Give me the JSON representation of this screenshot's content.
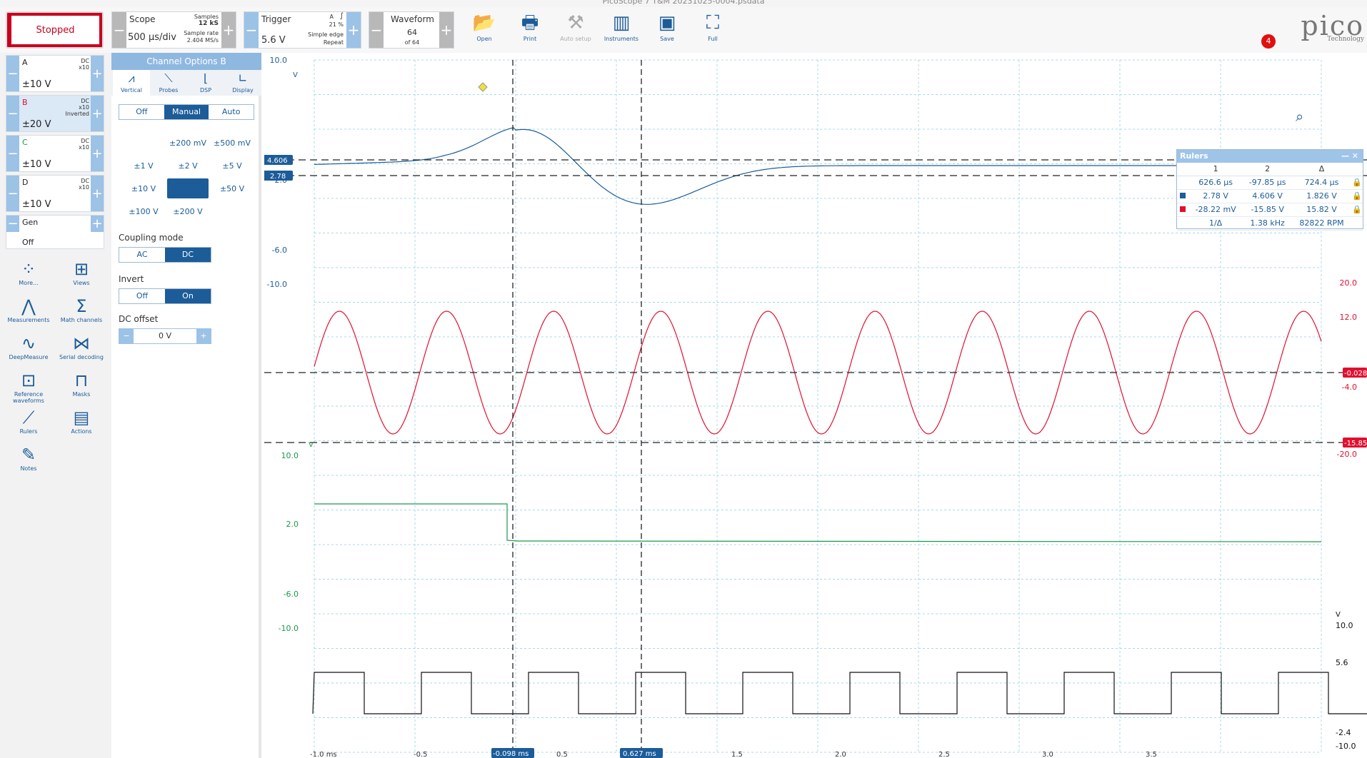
{
  "title": "PicoScope 7 T&M 20231025-0004.psdata",
  "toolbar": {
    "stop_label": "Stopped",
    "scope": {
      "label": "Scope",
      "timebase": "500 µs/div",
      "samples_label": "Samples",
      "samples": "12 kS",
      "rate_label": "Sample rate",
      "rate": "2.404 MS/s"
    },
    "trigger": {
      "label": "Trigger",
      "level": "5.6 V",
      "channel": "A",
      "pretrigger": "21 %",
      "type": "Simple edge",
      "mode": "Repeat"
    },
    "waveform": {
      "label": "Waveform",
      "current": "64",
      "of": "of 64"
    },
    "buttons": [
      {
        "label": "Open",
        "icon": "folder-icon"
      },
      {
        "label": "Print",
        "icon": "printer-icon"
      },
      {
        "label": "Auto setup",
        "icon": "wand-icon"
      },
      {
        "label": "Instruments",
        "icon": "instruments-icon"
      },
      {
        "label": "Save",
        "icon": "save-icon"
      },
      {
        "label": "Full",
        "icon": "fullscreen-icon"
      }
    ],
    "logo": "pico",
    "logo_sub": "Technology",
    "notifications": "4"
  },
  "channels": [
    {
      "name": "A",
      "coupling": "DC",
      "probe": "x10",
      "range": "±10 V",
      "extra": ""
    },
    {
      "name": "B",
      "coupling": "DC",
      "probe": "x10",
      "range": "±20 V",
      "extra": "Inverted"
    },
    {
      "name": "C",
      "coupling": "DC",
      "probe": "x10",
      "range": "±10 V",
      "extra": ""
    },
    {
      "name": "D",
      "coupling": "DC",
      "probe": "x10",
      "range": "±10 V",
      "extra": ""
    }
  ],
  "gen": {
    "name": "Gen",
    "state": "Off"
  },
  "tools": [
    "More...",
    "Views",
    "Measurements",
    "Math channels",
    "DeepMeasure",
    "Serial decoding",
    "Reference waveforms",
    "Masks",
    "Rulers",
    "Actions",
    "Notes"
  ],
  "channel_options": {
    "title": "Channel Options",
    "channel": "B",
    "tabs": [
      "Vertical",
      "Probes",
      "DSP",
      "Display"
    ],
    "range_mode": [
      "Off",
      "Manual",
      "Auto"
    ],
    "ranges": [
      "±200 mV",
      "±500 mV",
      "±1 V",
      "±2 V",
      "±5 V",
      "±10 V",
      "±20 V",
      "±50 V",
      "±100 V",
      "±200 V"
    ],
    "coupling_label": "Coupling mode",
    "coupling": [
      "AC",
      "DC"
    ],
    "invert_label": "Invert",
    "invert": [
      "Off",
      "On"
    ],
    "offset_label": "DC offset",
    "offset": "0 V"
  },
  "axes": {
    "blue": {
      "unit": "V",
      "ticks": [
        "10.0",
        "2.0",
        "-6.0",
        "-10.0"
      ],
      "marker1": "4.606",
      "marker2": "2.78"
    },
    "red": {
      "ticks": [
        "20.0",
        "12.0",
        "-4.0",
        "-20.0"
      ],
      "marker1": "-0.028",
      "marker2": "-15.85"
    },
    "green": {
      "unit": "V",
      "ticks": [
        "10.0",
        "2.0",
        "-6.0",
        "-10.0"
      ]
    },
    "black": {
      "unit": "V",
      "ticks": [
        "10.0",
        "5.6",
        "-2.4",
        "-10.0"
      ]
    },
    "time": [
      "-1.0 ms",
      "-0.5",
      "0.5",
      "1.0",
      "1.5",
      "2.0",
      "2.5",
      "3.0",
      "3.5"
    ],
    "ruler1": "-0.098 ms",
    "ruler2": "0.627 ms"
  },
  "rulers": {
    "title": "Rulers",
    "headers": [
      "",
      "1",
      "2",
      "Δ",
      ""
    ],
    "rows": [
      {
        "color": "",
        "v1": "626.6 µs",
        "v2": "-97.85 µs",
        "d": "724.4 µs"
      },
      {
        "color": "#1c5c99",
        "v1": "2.78 V",
        "v2": "4.606 V",
        "d": "1.826 V"
      },
      {
        "color": "#e01030",
        "v1": "-28.22 mV",
        "v2": "-15.85 V",
        "d": "15.82 V"
      }
    ],
    "inv": {
      "label": "1/Δ",
      "f": "1.38 kHz",
      "rpm": "82822 RPM"
    }
  }
}
